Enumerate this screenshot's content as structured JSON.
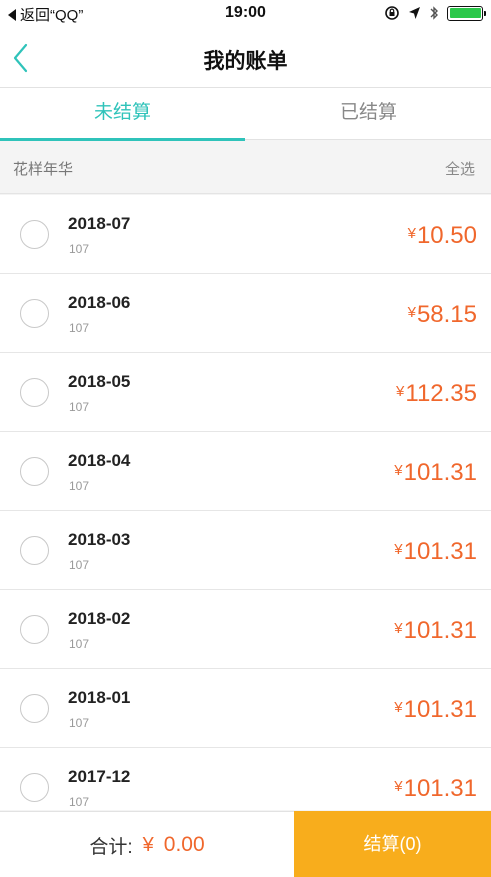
{
  "status_bar": {
    "back_text": "返回“QQ”",
    "time": "19:00"
  },
  "nav": {
    "title": "我的账单"
  },
  "tabs": [
    {
      "label": "未结算",
      "active": true
    },
    {
      "label": "已结算",
      "active": false
    }
  ],
  "group": {
    "name": "花样年华",
    "select_all": "全选"
  },
  "bills": [
    {
      "month": "2018-07",
      "sub": "107",
      "amount": "10.50"
    },
    {
      "month": "2018-06",
      "sub": "107",
      "amount": "58.15"
    },
    {
      "month": "2018-05",
      "sub": "107",
      "amount": "112.35"
    },
    {
      "month": "2018-04",
      "sub": "107",
      "amount": "101.31"
    },
    {
      "month": "2018-03",
      "sub": "107",
      "amount": "101.31"
    },
    {
      "month": "2018-02",
      "sub": "107",
      "amount": "101.31"
    },
    {
      "month": "2018-01",
      "sub": "107",
      "amount": "101.31"
    },
    {
      "month": "2017-12",
      "sub": "107",
      "amount": "101.31"
    }
  ],
  "currency_symbol": "¥",
  "footer": {
    "total_label": "合计:",
    "total_symbol": "¥",
    "total_value": "0.00",
    "checkout_label": "结算(0)"
  },
  "colors": {
    "accent": "#2fc3ba",
    "price": "#f0672c",
    "checkout": "#f8ad1c"
  },
  "icons": [
    "back-arrow-icon",
    "rotation-lock-icon",
    "location-arrow-icon",
    "bluetooth-icon",
    "battery-icon"
  ]
}
